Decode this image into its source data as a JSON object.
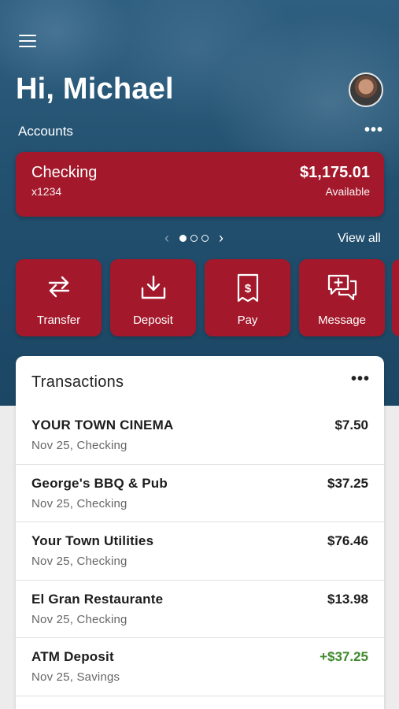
{
  "header": {
    "greeting": "Hi, Michael",
    "accounts_label": "Accounts",
    "more_icon": "ellipsis-icon"
  },
  "account_card": {
    "name": "Checking",
    "number": "x1234",
    "balance": "$1,175.01",
    "balance_label": "Available"
  },
  "pager": {
    "pages": 3,
    "current": 1,
    "view_all_label": "View all"
  },
  "actions": [
    {
      "label": "Transfer",
      "icon": "transfer-arrows-icon"
    },
    {
      "label": "Deposit",
      "icon": "download-tray-icon"
    },
    {
      "label": "Pay",
      "icon": "bill-dollar-icon"
    },
    {
      "label": "Message",
      "icon": "chat-plus-icon"
    }
  ],
  "transactions": {
    "title": "Transactions",
    "items": [
      {
        "merchant": "YOUR TOWN CINEMA",
        "detail": "Nov 25, Checking",
        "amount": "$7.50"
      },
      {
        "merchant": "George's BBQ & Pub",
        "detail": "Nov 25, Checking",
        "amount": "$37.25"
      },
      {
        "merchant": "Your Town Utilities",
        "detail": "Nov 25, Checking",
        "amount": "$76.46"
      },
      {
        "merchant": "El Gran Restaurante",
        "detail": "Nov 25, Checking",
        "amount": "$13.98"
      },
      {
        "merchant": "ATM Deposit",
        "detail": "Nov 25, Savings",
        "amount": "+$37.25"
      }
    ]
  },
  "colors": {
    "brand_red": "#a3192b",
    "hero_blue": "#22506f",
    "credit_green": "#3f8a2c"
  }
}
